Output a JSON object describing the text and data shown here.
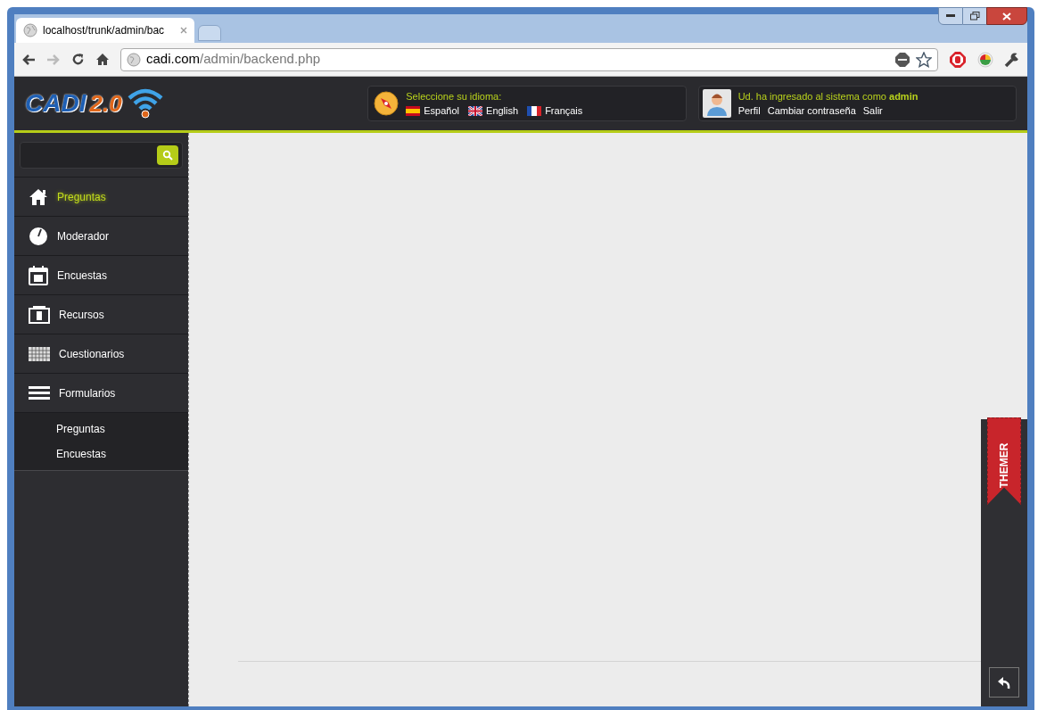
{
  "browser": {
    "tab": {
      "title": "localhost/trunk/admin/bac"
    },
    "address": {
      "host": "cadi.com",
      "path": "/admin/backend.php"
    }
  },
  "header": {
    "logo": {
      "name": "CADI",
      "version": "2.0"
    },
    "language": {
      "prompt": "Seleccione su idioma:",
      "options": [
        {
          "label": "Español"
        },
        {
          "label": "English"
        },
        {
          "label": "Français"
        }
      ]
    },
    "user": {
      "message": "Ud. ha ingresado al sistema como **admin**",
      "links": [
        "Perfil",
        "Cambiar contraseña",
        "Salir"
      ]
    }
  },
  "sidebar": {
    "items": [
      {
        "label": "Preguntas",
        "selected": true
      },
      {
        "label": "Moderador",
        "selected": false
      },
      {
        "label": "Encuestas",
        "selected": false
      },
      {
        "label": "Recursos",
        "selected": false
      },
      {
        "label": "Cuestionarios",
        "selected": false
      },
      {
        "label": "Formularios",
        "selected": false,
        "children": [
          {
            "label": "Preguntas"
          },
          {
            "label": "Encuestas"
          }
        ]
      }
    ]
  },
  "themer": {
    "label": "THEMER"
  }
}
